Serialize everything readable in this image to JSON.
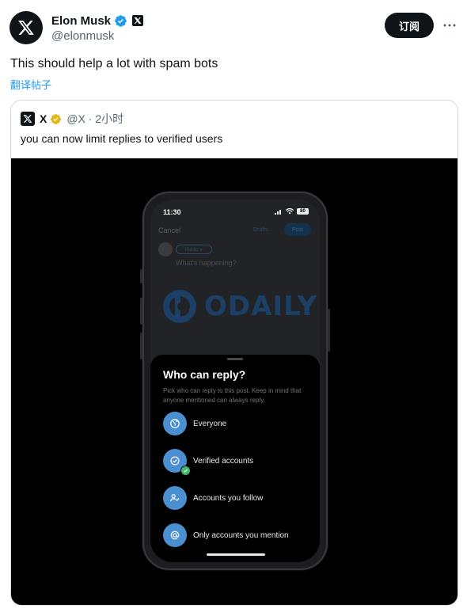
{
  "author": {
    "display_name": "Elon Musk",
    "handle": "@elonmusk",
    "avatar_icon": "x-logo-icon",
    "verified_color": "#1d9bf0"
  },
  "actions": {
    "subscribe_label": "订阅",
    "more_icon": "more-horizontal-icon"
  },
  "tweet": {
    "text": "This should help a lot with spam bots",
    "translate_label": "翻译帖子"
  },
  "quote": {
    "name": "X",
    "handle_time": "@X · 2小时",
    "text": "you can now limit replies to verified users",
    "badge_color": "#e2b719"
  },
  "media": {
    "phone": {
      "status_time": "11:30",
      "battery": "80",
      "cancel_label": "Cancel",
      "drafts_label": "Drafts",
      "post_label": "Post",
      "audience_label": "Public ∨",
      "compose_placeholder": "What's happening?",
      "watermark_text": "ODAILY",
      "sheet": {
        "title": "Who can reply?",
        "description": "Pick who can reply to this post. Keep in mind that anyone mentioned can always reply.",
        "options": [
          {
            "label": "Everyone",
            "icon": "globe-icon",
            "selected": false
          },
          {
            "label": "Verified accounts",
            "icon": "verified-icon",
            "selected": true
          },
          {
            "label": "Accounts you follow",
            "icon": "person-check-icon",
            "selected": false
          },
          {
            "label": "Only accounts you mention",
            "icon": "at-sign-icon",
            "selected": false
          }
        ],
        "accent_color": "#4a8fcf",
        "selected_color": "#3fb86b"
      }
    }
  }
}
